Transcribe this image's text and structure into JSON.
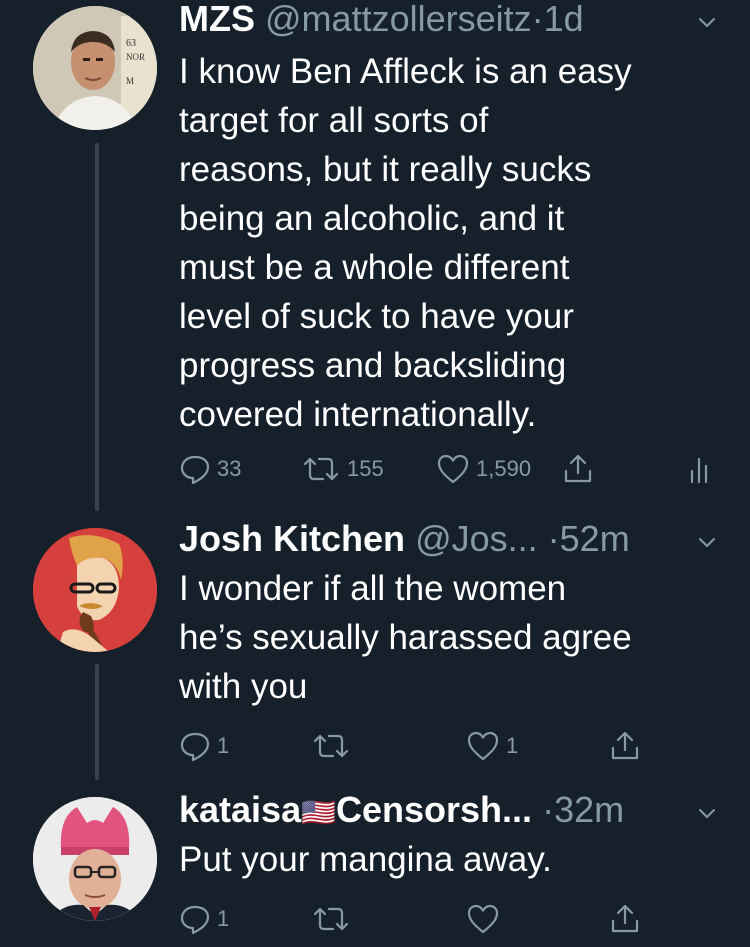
{
  "colors": {
    "background": "#15202b",
    "text": "#ffffff",
    "muted": "#8899a6",
    "thread_line": "#38444d"
  },
  "tweets": [
    {
      "name": "MZS",
      "handle": "@mattzollerseitz",
      "separator": "·",
      "time": "1d",
      "text_lines": [
        "I know Ben Affleck is an easy",
        "target for all sorts of",
        "reasons, but it really sucks",
        "being an alcoholic, and it",
        "must be a whole different",
        "level of suck to have your",
        "progress and backsliding",
        "covered internationally."
      ],
      "replies": "33",
      "retweets": "155",
      "likes": "1,590",
      "icons": [
        "reply-icon",
        "retweet-icon",
        "like-icon",
        "share-icon",
        "analytics-icon"
      ]
    },
    {
      "name": "Josh Kitchen",
      "handle": "@Jos...",
      "separator": "·",
      "time": "52m",
      "text_lines": [
        "I wonder if all the women",
        "he’s sexually harassed agree",
        "with you"
      ],
      "replies": "1",
      "retweets": "",
      "likes": "1",
      "icons": [
        "reply-icon",
        "retweet-icon",
        "like-icon",
        "share-icon"
      ]
    },
    {
      "name": "kataisa",
      "flag": "🇺🇸",
      "name_suffix": "Censorsh...",
      "separator": "·",
      "time": "32m",
      "text_lines": [
        "Put your mangina away."
      ],
      "replies": "1",
      "retweets": "",
      "likes": "",
      "icons": [
        "reply-icon",
        "retweet-icon",
        "like-icon",
        "share-icon"
      ]
    }
  ]
}
